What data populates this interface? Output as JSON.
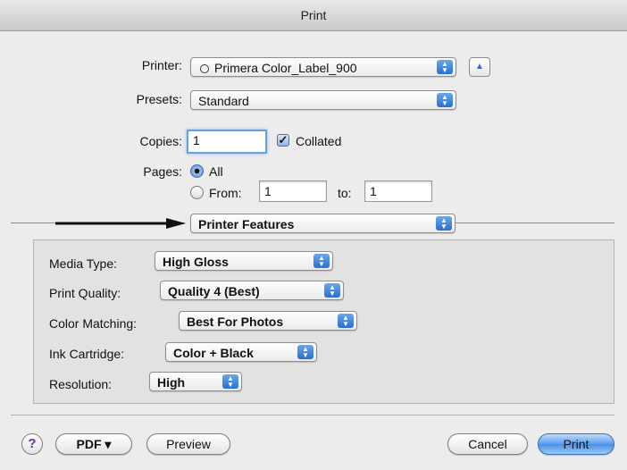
{
  "window": {
    "title": "Print"
  },
  "printer": {
    "label": "Printer:",
    "value": "Primera Color_Label_900"
  },
  "presets": {
    "label": "Presets:",
    "value": "Standard"
  },
  "copies": {
    "label": "Copies:",
    "value": "1",
    "collated_label": "Collated",
    "collated": true
  },
  "pages": {
    "label": "Pages:",
    "all_label": "All",
    "from_label": "From:",
    "from_value": "1",
    "to_label": "to:",
    "to_value": "1",
    "selected": "All"
  },
  "section": {
    "value": "Printer Features"
  },
  "features": [
    {
      "label": "Media Type:",
      "value": "High Gloss"
    },
    {
      "label": "Print Quality:",
      "value": "Quality 4 (Best)"
    },
    {
      "label": "Color Matching:",
      "value": "Best For Photos"
    },
    {
      "label": "Ink Cartridge:",
      "value": "Color + Black"
    },
    {
      "label": "Resolution:",
      "value": "High"
    }
  ],
  "footer": {
    "help": "?",
    "pdf": "PDF ▾",
    "preview": "Preview",
    "cancel": "Cancel",
    "print": "Print"
  },
  "icons": {
    "stepper": "up-down-arrows-icon",
    "eject": "disclosure-up-icon",
    "printer_status": "printer-status-icon",
    "arrow": "right-arrow-icon",
    "checkmark": "checkmark-icon"
  },
  "colors": {
    "accent": "#4a8fe6"
  }
}
